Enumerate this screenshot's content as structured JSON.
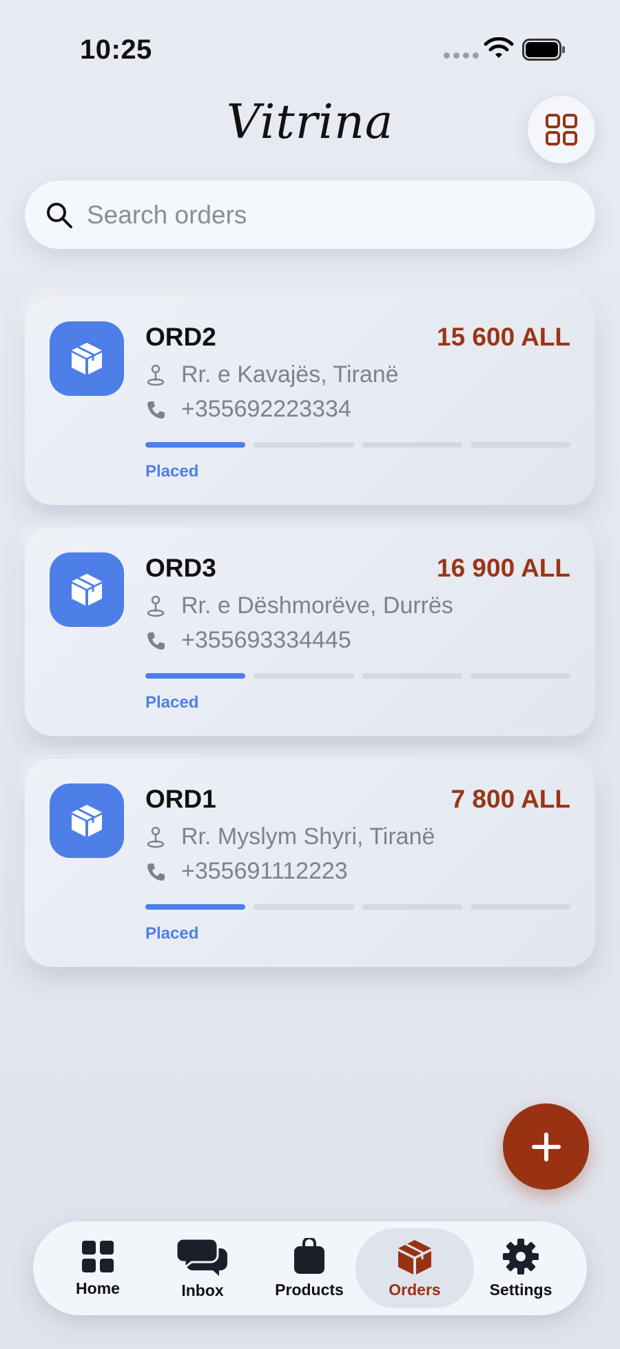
{
  "status_bar": {
    "time": "10:25"
  },
  "header": {
    "brand": "Vitrina"
  },
  "search": {
    "placeholder": "Search orders"
  },
  "orders": [
    {
      "id": "ORD2",
      "total": "15 600 ALL",
      "address": "Rr. e Kavajës, Tiranë",
      "phone": "+355692223334",
      "status": "Placed",
      "progress": 0.25
    },
    {
      "id": "ORD3",
      "total": "16 900 ALL",
      "address": "Rr. e Dëshmorëve, Durrës",
      "phone": "+355693334445",
      "status": "Placed",
      "progress": 0.25
    },
    {
      "id": "ORD1",
      "total": "7 800 ALL",
      "address": "Rr. Myslym Shyri, Tiranë",
      "phone": "+355691112223",
      "status": "Placed",
      "progress": 0.25
    }
  ],
  "tabs": [
    {
      "label": "Home",
      "icon": "grid-icon"
    },
    {
      "label": "Inbox",
      "icon": "chat-bubbles-icon"
    },
    {
      "label": "Products",
      "icon": "bag-icon"
    },
    {
      "label": "Orders",
      "icon": "box-icon",
      "active": true
    },
    {
      "label": "Settings",
      "icon": "gear-icon"
    }
  ],
  "colors": {
    "accent_blue": "#4e7fe8",
    "brand_rust": "#993213",
    "price_rust": "#9a3516",
    "background": "#e8ebf2"
  }
}
